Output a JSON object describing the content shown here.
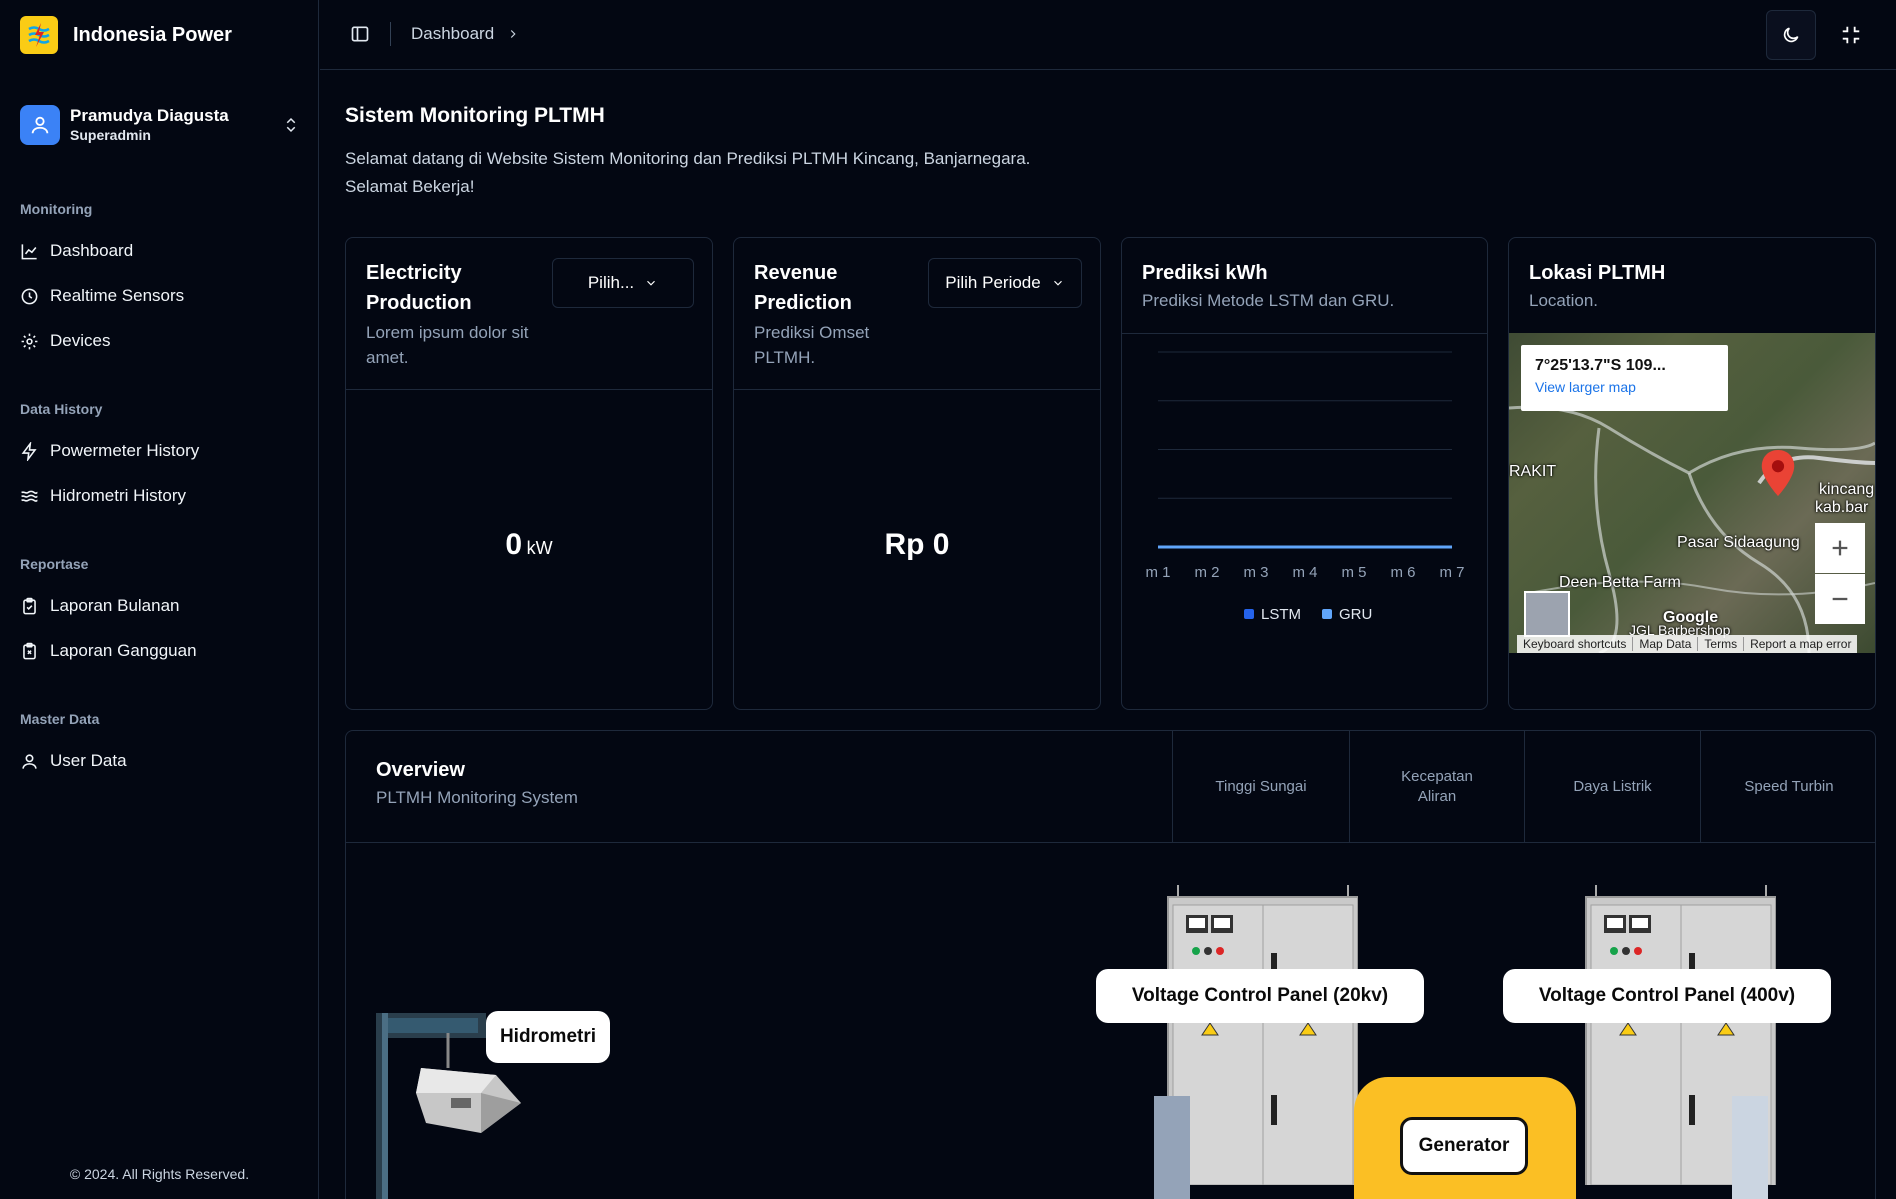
{
  "brand": {
    "name": "Indonesia Power"
  },
  "user": {
    "name": "Pramudya Diagusta",
    "role": "Superadmin"
  },
  "nav": {
    "groups": [
      {
        "label": "Monitoring",
        "items": [
          {
            "label": "Dashboard",
            "icon": "chart-line-icon"
          },
          {
            "label": "Realtime Sensors",
            "icon": "clock-icon"
          },
          {
            "label": "Devices",
            "icon": "gear-icon"
          }
        ]
      },
      {
        "label": "Data History",
        "items": [
          {
            "label": "Powermeter History",
            "icon": "zap-icon"
          },
          {
            "label": "Hidrometri History",
            "icon": "waves-icon"
          }
        ]
      },
      {
        "label": "Reportase",
        "items": [
          {
            "label": "Laporan Bulanan",
            "icon": "clipboard-check-icon"
          },
          {
            "label": "Laporan Gangguan",
            "icon": "clipboard-x-icon"
          }
        ]
      },
      {
        "label": "Master Data",
        "items": [
          {
            "label": "User Data",
            "icon": "user-icon"
          }
        ]
      }
    ]
  },
  "footer": {
    "copyright": "© 2024. All Rights Reserved."
  },
  "header": {
    "breadcrumb": "Dashboard"
  },
  "page": {
    "title": "Sistem Monitoring PLTMH",
    "desc_line1": "Selamat datang di Website Sistem Monitoring dan Prediksi PLTMH Kincang, Banjarnegara.",
    "desc_line2": "Selamat Bekerja!"
  },
  "cards": {
    "electricity": {
      "title_line1": "Electricity",
      "title_line2": "Production",
      "sub_line1": "Lorem ipsum dolor sit",
      "sub_line2": "amet.",
      "select": "Pilih...",
      "value": "0",
      "unit": "kW"
    },
    "revenue": {
      "title_line1": "Revenue",
      "title_line2": "Prediction",
      "sub_line1": "Prediksi Omset",
      "sub_line2": "PLTMH.",
      "select": "Pilih Periode",
      "value": "Rp 0"
    },
    "prediction": {
      "title": "Prediksi kWh",
      "sub": "Prediksi Metode LSTM dan GRU."
    },
    "location": {
      "title": "Lokasi PLTMH",
      "sub": "Location.",
      "popup_coord": "7°25'13.7\"S 109...",
      "popup_link": "View larger map",
      "labels": [
        "RAKIT",
        "kincang",
        "kab.bar",
        "Pasar Sidaagung",
        "Deen Betta Farm",
        "JGL Barbershop",
        "Google"
      ],
      "footer": [
        "Keyboard shortcuts",
        "Map Data",
        "Terms",
        "Report a map error"
      ]
    }
  },
  "chart_data": {
    "type": "line",
    "categories": [
      "m 1",
      "m 2",
      "m 3",
      "m 4",
      "m 5",
      "m 6",
      "m 7"
    ],
    "series": [
      {
        "name": "LSTM",
        "color": "#2563eb",
        "values": [
          0,
          0,
          0,
          0,
          0,
          0,
          0
        ]
      },
      {
        "name": "GRU",
        "color": "#60a5fa",
        "values": [
          0,
          0,
          0,
          0,
          0,
          0,
          0
        ]
      }
    ],
    "grid": true,
    "legend": "bottom"
  },
  "overview": {
    "title": "Overview",
    "sub": "PLTMH Monitoring System",
    "tabs": [
      "Tinggi Sungai",
      "Kecepatan Aliran",
      "Daya Listrik",
      "Speed Turbin"
    ],
    "tags": {
      "hidrometri": "Hidrometri",
      "panel20": "Voltage Control Panel (20kv)",
      "panel400": "Voltage Control Panel (400v)",
      "generator": "Generator"
    }
  },
  "colors": {
    "background": "#030712",
    "accent": "#3b82f6",
    "brand_yellow": "#facc15",
    "generator": "#fbbf24"
  }
}
